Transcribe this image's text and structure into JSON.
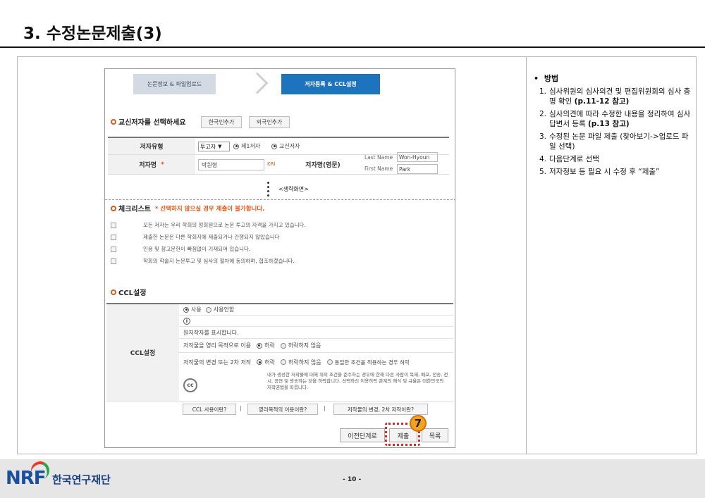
{
  "page": {
    "title": "3. 수정논문제출(3)",
    "page_number": "- 10 -",
    "org_name": "한국연구재단",
    "logo_text": "NRF"
  },
  "wizard": {
    "step1": "논문정보 & 파일업로드",
    "step2": "저자등록 & CCL설정"
  },
  "author_section": {
    "title": "교신저자를 선택하세요",
    "add_korean_btn": "한국인추가",
    "add_foreign_btn": "외국인추가",
    "type_label": "저자유형",
    "type_select": "투고자",
    "first_author": "제1저자",
    "corresponding_author": "교신저자",
    "name_label": "저자명",
    "required_mark": "*",
    "name_value": "박원형",
    "kri_label": "KRI",
    "eng_name_label": "저자명(영문)",
    "last_name_label": "Last Name",
    "last_name_value": "Won-Hyoun",
    "first_name_label": "First Name",
    "first_name_value": "Park"
  },
  "omitted_label": "<생략화면>",
  "checklist": {
    "title": "체크리스트",
    "warning": "* 선택하지 않으실 경우 제출이 불가합니다.",
    "items": [
      "모든 저자는 우리 학회의 정회원으로 논문 투고의 자격을 가지고 있습니다.",
      "제출한 논문은 다른 학회지에 제출되거나 간행되지 않았습니다",
      "인용 및 참고문헌이 빠짐없이 기재되어 있습니다.",
      "학회의 학술지 논문투고 및 심사의 절차에 동의하며, 협조하겠습니다."
    ]
  },
  "ccl": {
    "title": "CCL설정",
    "label": "CCL설정",
    "use": "사용",
    "not_use": "사용안함",
    "info_icon_text": "i",
    "attribution": "원저작자를 표시합니다.",
    "commercial_label": "저작물을 영리 목적으로 이용",
    "allow": "허락",
    "disallow": "허락하지 않음",
    "modification_label": "저작물의 변경 또는 2차 저작",
    "same_condition": "동일한 조건을 적용하는 경우 허락",
    "cc_icon_text": "cc",
    "notice": "내가 생성한 저작물에 대해 위의 조건을 준수하는 경우에 한해 다른 사람이 복제, 배포, 전송, 전시, 공연 및 방송하는 것을 허락합니다. 선택하신 이용허락 관계의 해석 및 규율은 대한민국의 저작권법을 따릅니다.",
    "link1": "CCL 사용이란?",
    "link2": "영리목적의 이용이란?",
    "link3": "저작물의 변경, 2차 저작이란?",
    "separator": "|"
  },
  "actions": {
    "prev": "이전단계로",
    "submit": "제출",
    "list": "목록",
    "step_badge": "7"
  },
  "method": {
    "bullet": "•",
    "title": "방법",
    "steps": [
      {
        "n": "1.",
        "text": "심사위원의 심사의견 및 편집위원회의 심사 총평 확인 ",
        "bold": "(p.11-12 참고)"
      },
      {
        "n": "2.",
        "text": "심사의견에 따라 수정한 내용을 정리하여 심사답변서 등록 ",
        "bold": "(p.13 참고)"
      },
      {
        "n": "3.",
        "text": "수정된 논문 파일 제출 (찾아보기->업로드 파일 선택)",
        "bold": ""
      },
      {
        "n": "4.",
        "text": "다음단계로 선택",
        "bold": ""
      },
      {
        "n": "5.",
        "text": "저자정보 등 필요 시 수정 후 “제출”",
        "bold": ""
      }
    ]
  },
  "colors": {
    "accent_orange": "#e05a1c",
    "wizard_active": "#1e73be",
    "highlight_red": "#e0261b",
    "badge_orange": "#f3a320",
    "brand_blue": "#1a4fa0"
  }
}
